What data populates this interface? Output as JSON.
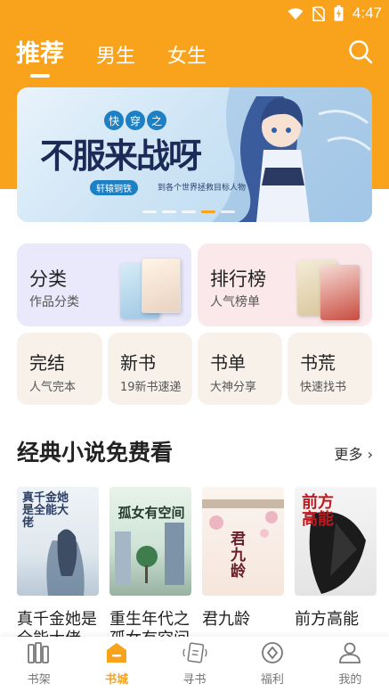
{
  "status_bar": {
    "time": "4:47"
  },
  "top_tabs": [
    {
      "label": "推荐",
      "active": true
    },
    {
      "label": "男生",
      "active": false
    },
    {
      "label": "女生",
      "active": false
    }
  ],
  "banner": {
    "tag_chars": [
      "快",
      "穿",
      "之"
    ],
    "title": "不服来战呀",
    "author": "轩辕铜铁",
    "slogan": "到各个世界拯救目标人物",
    "page_dots": 5,
    "active_dot": 3
  },
  "categories_big": [
    {
      "title": "分类",
      "subtitle": "作品分类"
    },
    {
      "title": "排行榜",
      "subtitle": "人气榜单"
    }
  ],
  "categories_small": [
    {
      "title": "完结",
      "subtitle": "人气完本"
    },
    {
      "title": "新书",
      "subtitle": "19新书速递"
    },
    {
      "title": "书单",
      "subtitle": "大神分享"
    },
    {
      "title": "书荒",
      "subtitle": "快速找书"
    }
  ],
  "section": {
    "title": "经典小说免费看",
    "more": "更多 ›"
  },
  "books": [
    {
      "name": "真千金她是全能大佬"
    },
    {
      "name": "重生年代之孤女有空间"
    },
    {
      "name": "君九龄"
    },
    {
      "name": "前方高能"
    }
  ],
  "covers": {
    "book1_text": "真千金她是全能大佬",
    "book2_text": "孤女有空间",
    "book3_text": "君九龄",
    "book4_text": "前方高能"
  },
  "bottom_nav": [
    {
      "label": "书架",
      "icon": "bookshelf-icon",
      "active": false
    },
    {
      "label": "书城",
      "icon": "bookstore-icon",
      "active": true
    },
    {
      "label": "寻书",
      "icon": "find-book-icon",
      "active": false
    },
    {
      "label": "福利",
      "icon": "welfare-icon",
      "active": false
    },
    {
      "label": "我的",
      "icon": "profile-icon",
      "active": false
    }
  ],
  "colors": {
    "accent": "#f9a21b"
  }
}
